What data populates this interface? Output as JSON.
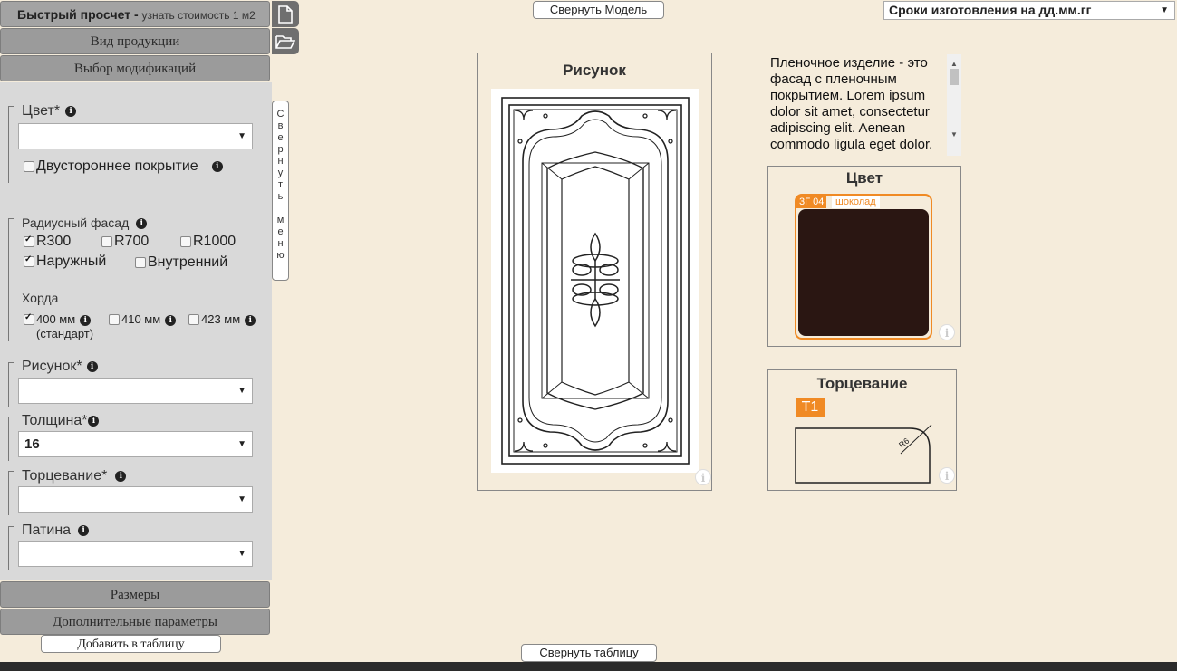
{
  "sidebar": {
    "quick_calc": {
      "title": "Быстрый просчет -",
      "subtitle": "узнать стоимость 1 м2"
    },
    "sections": {
      "product_type": "Вид продукции",
      "modifications": "Выбор модификаций",
      "sizes": "Размеры",
      "extra": "Дополнительные параметры"
    },
    "color": {
      "label": "Цвет*",
      "value": "",
      "double_side": "Двустороннее покрытие"
    },
    "radius": {
      "label": "Радиусный фасад",
      "options": [
        "R300",
        "R700",
        "R1000"
      ],
      "checked": [
        true,
        false,
        false
      ],
      "outer": "Наружный",
      "outer_checked": true,
      "inner": "Внутренний",
      "inner_checked": false
    },
    "chord": {
      "label": "Хорда",
      "options": [
        "400 мм",
        "410 мм",
        "423 мм"
      ],
      "checked": [
        true,
        false,
        false
      ],
      "standard": "(стандарт)"
    },
    "pattern": {
      "label": "Рисунок*",
      "value": ""
    },
    "thickness": {
      "label": "Толщина*",
      "value": "16"
    },
    "edging": {
      "label": "Торцевание*",
      "value": ""
    },
    "patina": {
      "label": "Патина",
      "value": ""
    },
    "add_button": "Добавить в таблицу",
    "collapse_menu": [
      "С",
      "в",
      "е",
      "р",
      "н",
      "у",
      "т",
      "ь",
      "",
      "м",
      "е",
      "н",
      "ю"
    ]
  },
  "toolbar": {
    "collapse_model": "Свернуть Модель",
    "collapse_table": "Свернуть таблицу",
    "deadline": "Сроки изготовления на дд.мм.гг"
  },
  "preview": {
    "pattern_title": "Рисунок",
    "description": "Пленочное изделие - это фасад с пленочным покрытием. Lorem ipsum dolor sit amet, consectetur adipiscing elit. Aenean commodo ligula eget dolor.",
    "color_title": "Цвет",
    "color_code": "3Г 04",
    "color_name": "шоколад",
    "color_hex": "#2a1612",
    "accent": "#f08a24",
    "edging_title": "Торцевание",
    "edging_code": "T1",
    "edging_radius": "R6"
  },
  "icons": {
    "info": "info-icon",
    "file": "file-icon",
    "folder": "folder-open-icon"
  }
}
